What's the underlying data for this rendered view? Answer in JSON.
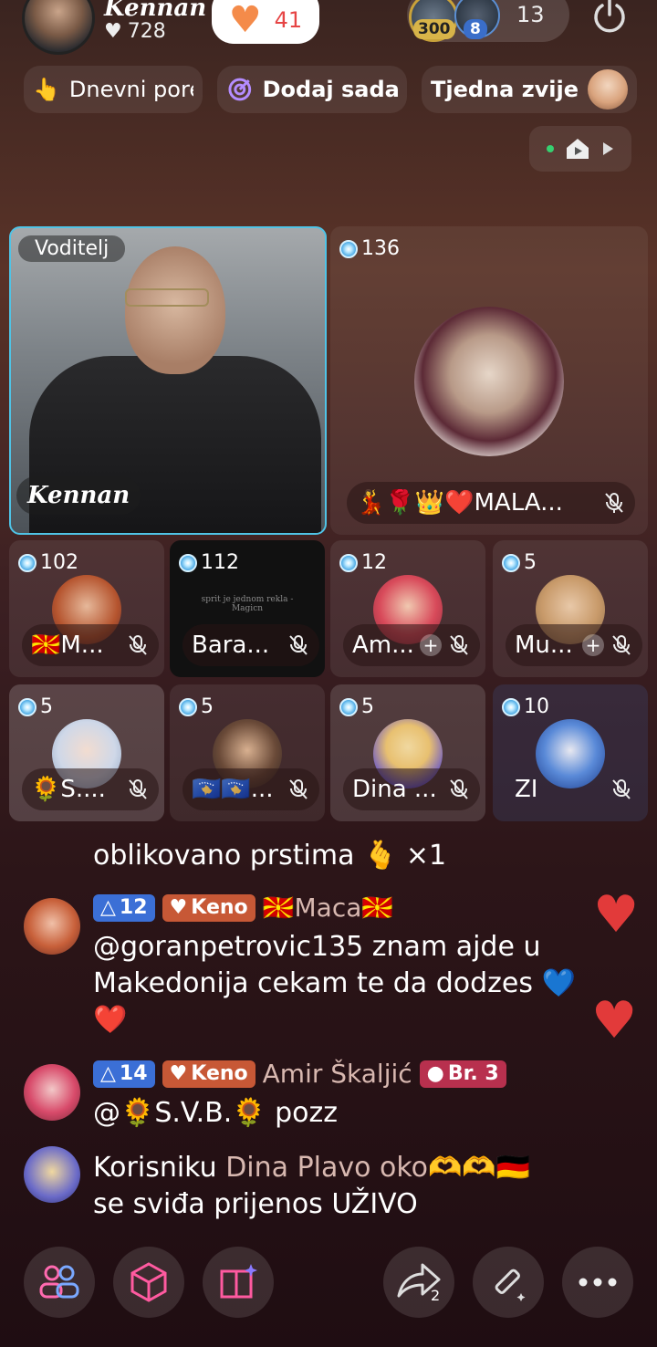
{
  "header": {
    "host_name": "Kennan",
    "host_likes": "728",
    "follow_count": "41",
    "viewer1_badge": "300",
    "viewer2_badge": "8",
    "viewer_count": "13"
  },
  "pills": {
    "daily": "Dnevni pore",
    "add_now": "Dodaj sada",
    "weekly_star": "Tjedna zvijezd"
  },
  "host_tile": {
    "role_label": "Voditelj",
    "name": "Kennan"
  },
  "big_tile": {
    "gems": "136",
    "name": "💃🌹👑❤️MALA..."
  },
  "tiles": [
    {
      "gems": "102",
      "name": "🇲🇰M...",
      "muted": true
    },
    {
      "gems": "112",
      "name": "Bara...",
      "muted": true,
      "caption": "sprit je jednom rekla - Magicn"
    },
    {
      "gems": "12",
      "name": "Am...",
      "muted": true,
      "plus": true
    },
    {
      "gems": "5",
      "name": "Mu...",
      "muted": true,
      "plus": true
    },
    {
      "gems": "5",
      "name": "🌻S....",
      "muted": true
    },
    {
      "gems": "5",
      "name": "🇽🇰🇽🇰...",
      "muted": true
    },
    {
      "gems": "5",
      "name": "Dina ...",
      "muted": true
    },
    {
      "gems": "10",
      "name": "ZI",
      "muted": true
    }
  ],
  "chat": {
    "line0": "oblikovano prstima 🫰 ×1",
    "msg1": {
      "level": "12",
      "keno": "Keno",
      "user": "🇲🇰Maca🇲🇰",
      "text": "@goranpetrovic135 znam ajde u Makedonija cekam te da dodzes 💙❤️"
    },
    "msg2": {
      "level": "14",
      "keno": "Keno",
      "user": "Amir Škaljić",
      "badge": "Br. 3",
      "text": "@🌻S.V.B.🌻  pozz"
    },
    "msg3": {
      "prefix": "Korisniku",
      "user": "Dina Plavo oko🫶🫶🇩🇪",
      "text": "se sviđa prijenos UŽIVO"
    }
  },
  "bottom_bar": {
    "share_count": "2"
  },
  "icons": [
    "heart-icon",
    "power-icon",
    "pointing-hand-icon",
    "gem-icon",
    "mute-icon",
    "plus-icon",
    "users-icon",
    "cube-icon",
    "book-sparkle-icon",
    "share-icon",
    "magic-wand-icon",
    "more-icon",
    "home-icon",
    "play-icon"
  ]
}
